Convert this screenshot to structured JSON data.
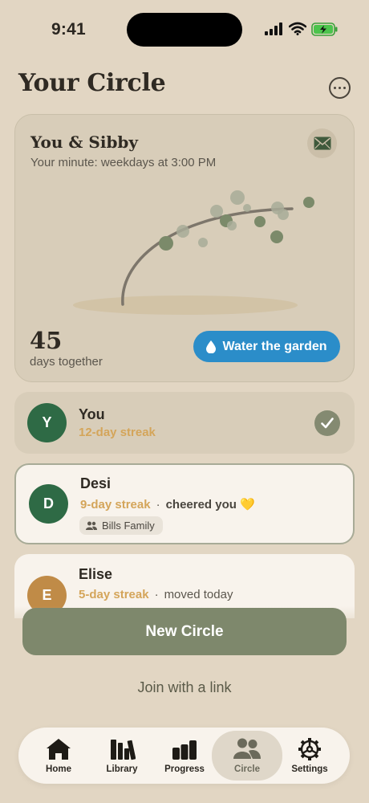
{
  "status_bar": {
    "time": "9:41"
  },
  "header": {
    "title": "Your Circle"
  },
  "garden_card": {
    "circle_name": "You & Sibby",
    "schedule": "Your minute: weekdays at 3:00 PM",
    "days_count": "45",
    "days_label": "days together",
    "water_button": "Water the garden"
  },
  "members": [
    {
      "initial": "Y",
      "name": "You",
      "streak": "12-day streak",
      "avatar_color": "#2e6a45",
      "checked": true
    },
    {
      "initial": "D",
      "name": "Desi",
      "streak": "9-day streak",
      "note": "cheered you 💛",
      "tag": "Bills Family",
      "avatar_color": "#2e6a45"
    },
    {
      "initial": "E",
      "name": "Elise",
      "streak": "5-day streak",
      "note": "moved today",
      "avatar_color": "#c08b47"
    }
  ],
  "actions": {
    "new_circle": "New Circle",
    "join_link": "Join with a link"
  },
  "tabbar": {
    "items": [
      {
        "label": "Home",
        "icon": "home-icon"
      },
      {
        "label": "Library",
        "icon": "library-icon"
      },
      {
        "label": "Progress",
        "icon": "progress-icon"
      },
      {
        "label": "Circle",
        "icon": "people-icon",
        "active": true
      },
      {
        "label": "Settings",
        "icon": "gear-icon"
      }
    ]
  },
  "colors": {
    "accent_blue": "#2b8dc9",
    "primary_green": "#7e886c",
    "streak_gold": "#d4a55a",
    "background": "#e2d6c3"
  }
}
